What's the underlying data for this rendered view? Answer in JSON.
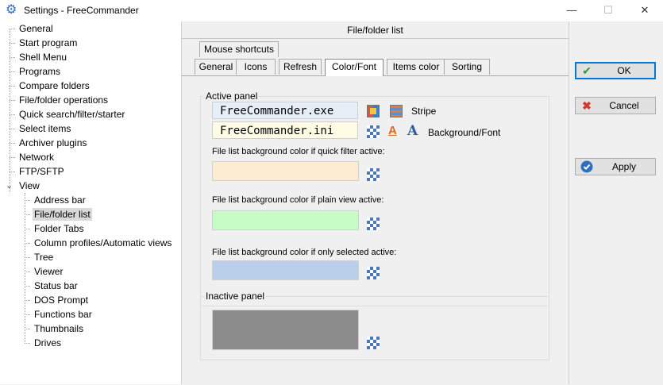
{
  "window": {
    "title": "Settings - FreeCommander",
    "icon": "gear-icon"
  },
  "tree": {
    "items": [
      {
        "label": "General"
      },
      {
        "label": "Start program"
      },
      {
        "label": "Shell Menu"
      },
      {
        "label": "Programs"
      },
      {
        "label": "Compare folders"
      },
      {
        "label": "File/folder operations"
      },
      {
        "label": "Quick search/filter/starter"
      },
      {
        "label": "Select items"
      },
      {
        "label": "Archiver plugins"
      },
      {
        "label": "Network"
      },
      {
        "label": "FTP/SFTP"
      },
      {
        "label": "View",
        "expanded": true
      }
    ],
    "children": [
      {
        "label": "Address bar"
      },
      {
        "label": "File/folder list",
        "selected": true
      },
      {
        "label": "Folder Tabs"
      },
      {
        "label": "Column profiles/Automatic views"
      },
      {
        "label": "Tree"
      },
      {
        "label": "Viewer"
      },
      {
        "label": "Status bar"
      },
      {
        "label": "DOS Prompt"
      },
      {
        "label": "Functions bar"
      },
      {
        "label": "Thumbnails"
      },
      {
        "label": "Drives"
      }
    ]
  },
  "header": {
    "title": "File/folder list"
  },
  "tabs": {
    "row1": [
      {
        "label": "Mouse shortcuts"
      }
    ],
    "row2": [
      {
        "label": "General"
      },
      {
        "label": "Icons"
      },
      {
        "label": "Refresh"
      },
      {
        "label": "Color/Font",
        "active": true
      },
      {
        "label": "Items color"
      },
      {
        "label": "Sorting"
      }
    ]
  },
  "active_panel": {
    "legend": "Active panel",
    "file1": "FreeCommander.exe",
    "file2": "FreeCommander.ini",
    "stripe_label": "Stripe",
    "bgfont_label": "Background/Font",
    "quick_filter_label": "File list background color if quick filter active:",
    "plain_view_label": "File list background color if plain view active:",
    "only_selected_label": "File list background color if only selected active:",
    "colors": {
      "file1_bg": "#e6eef8",
      "file2_bg": "#fffce6",
      "quick_filter": "#fdebd2",
      "plain_view": "#c6fcc6",
      "only_selected": "#b9cfea"
    }
  },
  "inactive_panel": {
    "legend": "Inactive panel",
    "color": "#8c8c8c"
  },
  "buttons": {
    "ok": "OK",
    "cancel": "Cancel",
    "apply": "Apply"
  }
}
